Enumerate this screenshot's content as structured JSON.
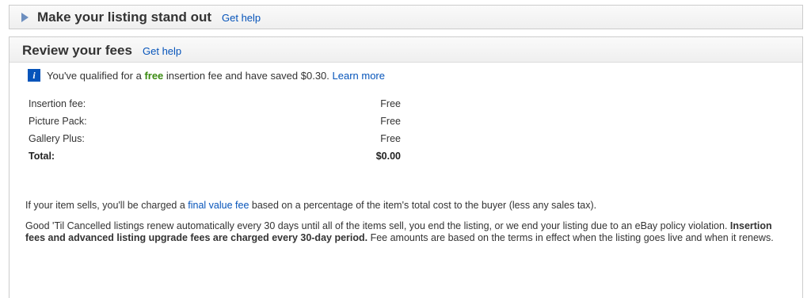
{
  "stand_out": {
    "title": "Make your listing stand out",
    "help": "Get help"
  },
  "review": {
    "title": "Review your fees",
    "help": "Get help",
    "notice": {
      "prefix": "You've qualified for a ",
      "highlight": "free",
      "suffix": " insertion fee and have saved $0.30. ",
      "link": "Learn more"
    },
    "fees": [
      {
        "label": "Insertion fee:",
        "value": "Free"
      },
      {
        "label": "Picture Pack:",
        "value": "Free"
      },
      {
        "label": "Gallery Plus:",
        "value": "Free"
      }
    ],
    "total": {
      "label": "Total:",
      "value": "$0.00"
    },
    "paragraph1": {
      "before": "If your item sells, you'll be charged a ",
      "link": "final value fee",
      "after": " based on a percentage of the item's total cost to the buyer (less any sales tax)."
    },
    "paragraph2": {
      "before": "Good 'Til Cancelled listings renew automatically every 30 days until all of the items sell, you end the listing, or we end your listing due to an eBay policy violation. ",
      "bold": "Insertion fees and advanced listing upgrade fees are charged every 30-day period.",
      "after": " Fee amounts are based on the terms in effect when the listing goes live and when it renews."
    }
  },
  "colors": {
    "link": "#0654ba",
    "free": "#3a8a10",
    "info_icon_bg": "#0654ba",
    "triangle": "#6d8fbf"
  }
}
